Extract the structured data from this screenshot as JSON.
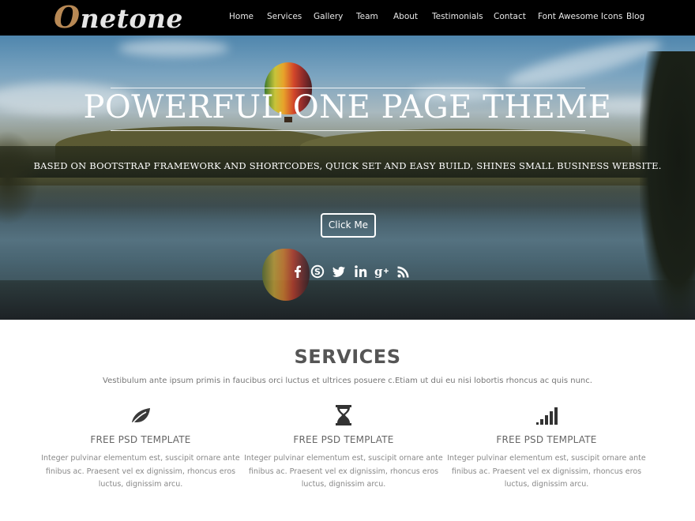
{
  "header": {
    "logo_first": "O",
    "logo_rest": "netone",
    "nav": [
      "Home",
      "Services",
      "Gallery",
      "Team",
      "About",
      "Testimonials",
      "Contact",
      "Font Awesome Icons",
      "Blog"
    ]
  },
  "hero": {
    "title": "POWERFUL ONE PAGE THEME",
    "subtitle": "BASED ON BOOTSTRAP FRAMEWORK AND SHORTCODES, QUICK SET AND EASY BUILD, SHINES SMALL BUSINESS WEBSITE.",
    "button_label": "Click Me",
    "social_icons": [
      "facebook-icon",
      "skype-icon",
      "twitter-icon",
      "linkedin-icon",
      "google-plus-icon",
      "rss-icon"
    ]
  },
  "services": {
    "title": "SERVICES",
    "intro": "Vestibulum ante ipsum primis in faucibus orci luctus et ultrices posuere c.Etiam ut dui eu nisi lobortis rhoncus ac quis nunc.",
    "items": [
      {
        "icon": "leaf-icon",
        "title": "FREE PSD TEMPLATE",
        "body": "Integer pulvinar elementum est, suscipit ornare ante finibus ac. Praesent vel ex dignissim, rhoncus eros luctus, dignissim arcu."
      },
      {
        "icon": "hourglass-icon",
        "title": "FREE PSD TEMPLATE",
        "body": "Integer pulvinar elementum est, suscipit ornare ante finibus ac. Praesent vel ex dignissim, rhoncus eros luctus, dignissim arcu."
      },
      {
        "icon": "signal-icon",
        "title": "FREE PSD TEMPLATE",
        "body": "Integer pulvinar elementum est, suscipit ornare ante finibus ac. Praesent vel ex dignissim, rhoncus eros luctus, dignissim arcu."
      }
    ]
  },
  "colors": {
    "header_bg": "#000000",
    "logo_accent": "#b88955",
    "heading_gray": "#555555"
  }
}
